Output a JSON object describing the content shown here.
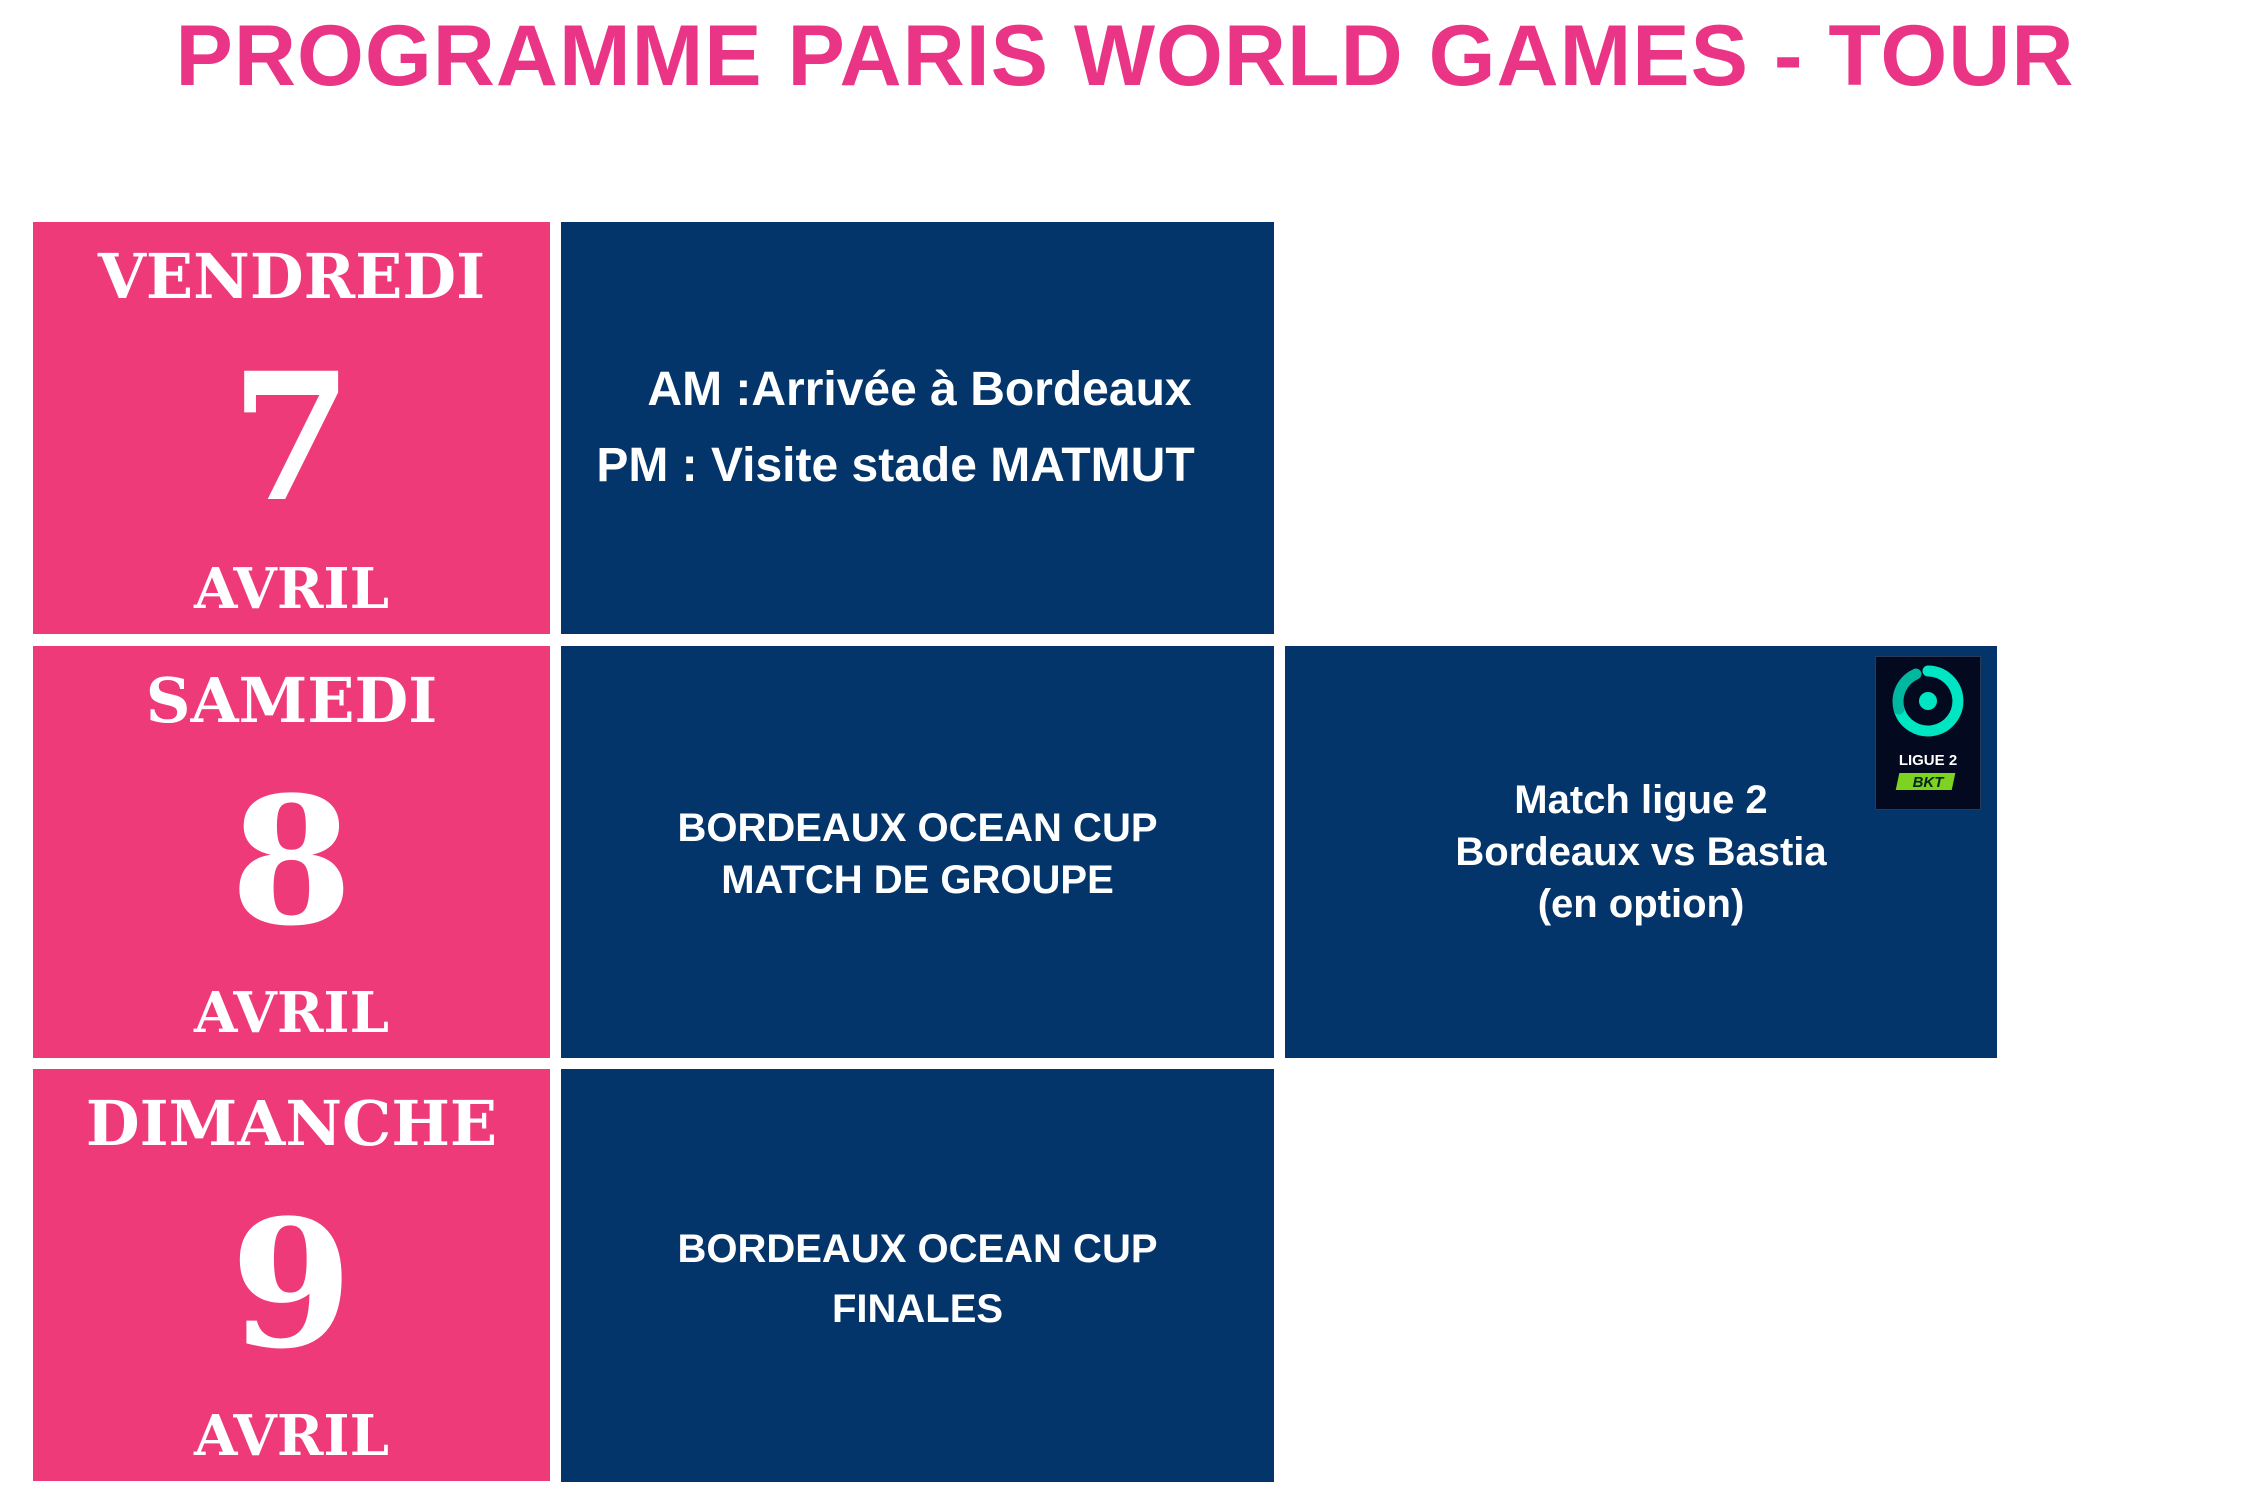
{
  "title": "PROGRAMME PARIS WORLD GAMES - TOUR",
  "colors": {
    "title": "#ea3485",
    "day_background": "#ee3a78",
    "panel_background": "#04356a",
    "text_on_tiles": "#ffffff",
    "logo_accent": "#00e6c3",
    "logo_bkt": "#7ed321"
  },
  "days": [
    {
      "weekday": "VENDREDI",
      "number": "7",
      "month": "AVRIL",
      "program": [
        "AM :Arrivée à Bordeaux",
        "PM : Visite stade MATMUT"
      ]
    },
    {
      "weekday": "SAMEDI",
      "number": "8",
      "month": "AVRIL",
      "program": [
        "BORDEAUX OCEAN CUP",
        "MATCH DE GROUPE"
      ],
      "extra": {
        "lines": [
          "Match ligue 2",
          "Bordeaux vs Bastia",
          "(en option)"
        ],
        "logo": {
          "icon": "ligue-2-bkt-logo",
          "text": "LIGUE 2",
          "sponsor": "BKT"
        }
      }
    },
    {
      "weekday": "DIMANCHE",
      "number": "9",
      "month": "AVRIL",
      "program": [
        "BORDEAUX OCEAN CUP",
        "FINALES"
      ]
    }
  ]
}
